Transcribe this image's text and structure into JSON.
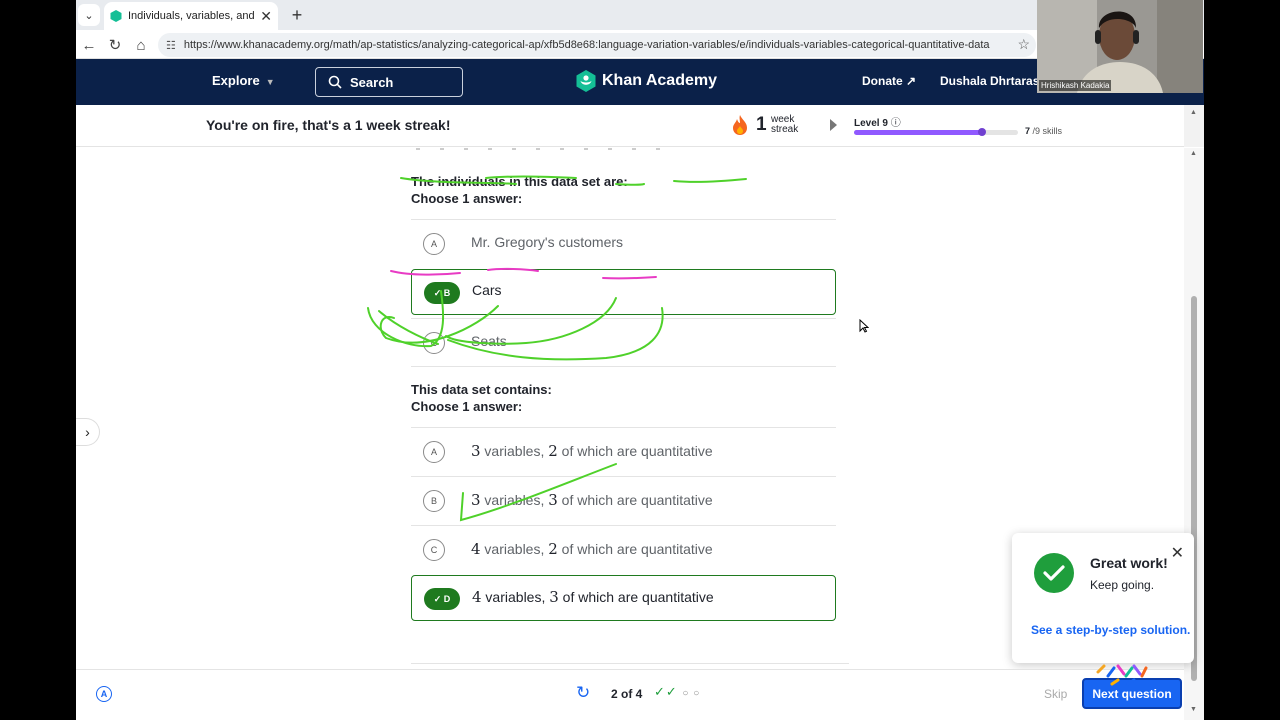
{
  "browser": {
    "tab_title": "Individuals, variables, and categorical",
    "url": "https://www.khanacademy.org/math/ap-statistics/analyzing-categorical-ap/xfb5d8e68:language-variation-variables/e/individuals-variables-categorical-quantitative-data"
  },
  "header": {
    "explore": "Explore",
    "search": "Search",
    "logo": "Khan Academy",
    "donate": "Donate",
    "user": "Dushala Dhrtarash"
  },
  "streak": {
    "message": "You're on fire, that's a 1 week streak!",
    "count": "1",
    "label_line1": "week",
    "label_line2": "streak",
    "level": "Level 9",
    "level_progress": 0.78,
    "skills_count": "7",
    "skills_total": "/9 skills"
  },
  "question1": {
    "prompt": "The individuals in this data set are:",
    "instruction": "Choose 1 answer:",
    "choices": [
      {
        "letter": "A",
        "text": "Mr. Gregory's customers"
      },
      {
        "letter": "B",
        "text": "Cars"
      },
      {
        "letter": "C",
        "text": "Seats"
      }
    ]
  },
  "question2": {
    "prompt": "This data set contains:",
    "instruction": "Choose 1 answer:",
    "choices": [
      {
        "letter": "A",
        "n1": "3",
        "mid": " variables, ",
        "n2": "2",
        "end": " of which are quantitative"
      },
      {
        "letter": "B",
        "n1": "3",
        "mid": " variables, ",
        "n2": "3",
        "end": " of which are quantitative"
      },
      {
        "letter": "C",
        "n1": "4",
        "mid": " variables, ",
        "n2": "2",
        "end": " of which are quantitative"
      },
      {
        "letter": "D",
        "n1": "4",
        "mid": " variables, ",
        "n2": "3",
        "end": " of which are quantitative"
      }
    ]
  },
  "toast": {
    "title": "Great work!",
    "subtitle": "Keep going.",
    "link": "See a step-by-step solution."
  },
  "footer": {
    "progress": "2 of 4",
    "skip": "Skip",
    "next": "Next question"
  },
  "webcam": {
    "name": "Hrishikash Kadakia"
  },
  "colors": {
    "ka_navy": "#0b2149",
    "correct_green": "#1f7a1f",
    "link_blue": "#1865f2",
    "level_purple": "#9059ff",
    "annotation_green": "#4fd12a",
    "annotation_pink": "#e83bc4"
  }
}
